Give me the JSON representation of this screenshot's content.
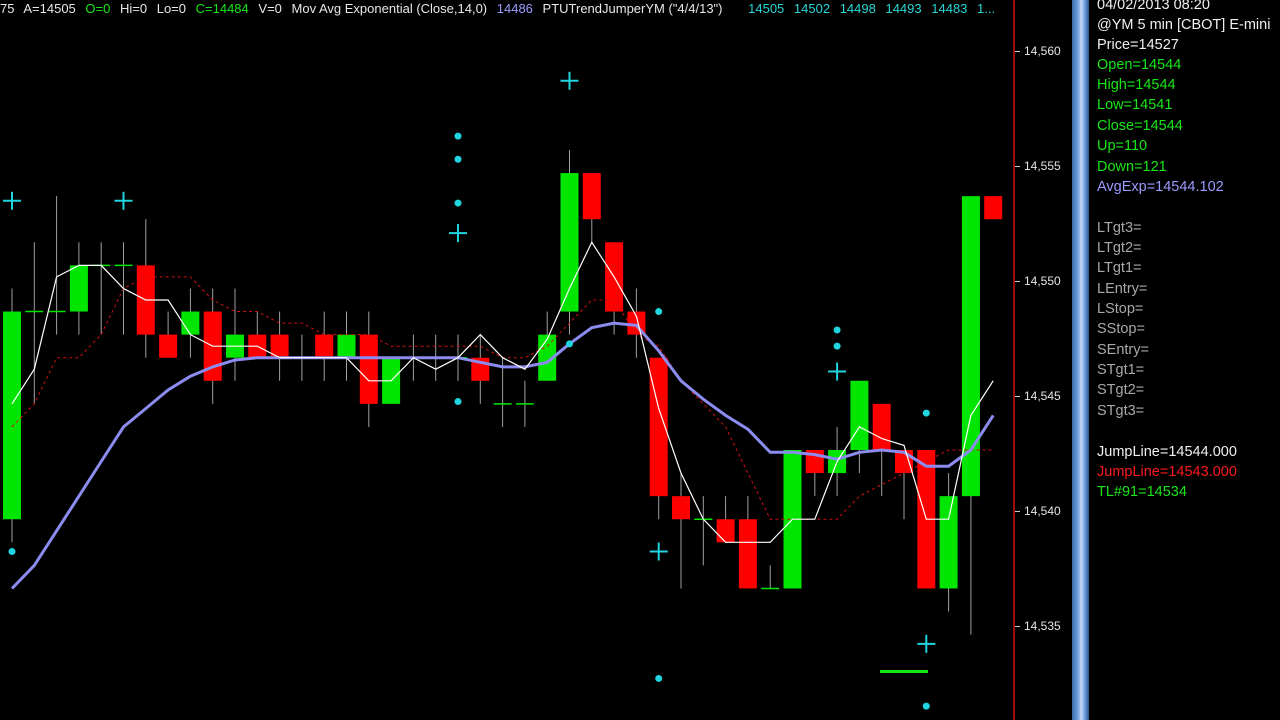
{
  "header": {
    "partial": "75",
    "ask": "A=14505",
    "open": "O=0",
    "high": "Hi=0",
    "low": "Lo=0",
    "close": "C=14484",
    "volume": "V=0",
    "indicator1_name": "Mov Avg Exponential (Close,14,0)",
    "indicator1_value": "14486",
    "indicator2_name": "PTUTrendJumperYM (\"4/4/13\")",
    "indicator2_values": [
      "14505",
      "14502",
      "14498",
      "14493",
      "14483",
      "1..."
    ]
  },
  "colors": {
    "background": "#000000",
    "up_candle": "#00e600",
    "down_candle": "#ff0000",
    "ema": "#8c8cf0",
    "trend_line": "#ffffff",
    "dotted_line": "#cc1111",
    "markers": "#20d4e0",
    "jump_line": "#19e619",
    "cursor_line": "#d01010"
  },
  "price_axis": {
    "ticks": [
      "14,560",
      "14,555",
      "14,550",
      "14,545",
      "14,540",
      "14,535"
    ]
  },
  "info_panel": {
    "datetime": "04/02/2013 08:20",
    "symbol": "@YM 5 min [CBOT] E-mini",
    "price": "Price=14527",
    "open": "Open=14544",
    "high": "High=14544",
    "low": "Low=14541",
    "close": "Close=14544",
    "up": "Up=110",
    "down": "Down=121",
    "avg_exp": "AvgExp=14544.102",
    "targets": [
      "LTgt3=",
      "LTgt2=",
      "LTgt1=",
      "LEntry=",
      "LStop=",
      "SStop=",
      "SEntry=",
      "STgt1=",
      "STgt2=",
      "STgt3="
    ],
    "jumpline_green": "JumpLine=14544.000",
    "jumpline_red": "JumpLine=14543.000",
    "tl": "TL#91=14534"
  },
  "chart_data": {
    "type": "candlestick",
    "title": "@YM 5 min [CBOT] E-mini",
    "ylim": [
      14532.3,
      14563.5
    ],
    "y_ticks": [
      14535,
      14540,
      14545,
      14550,
      14555,
      14560
    ],
    "bars": [
      {
        "o": 14541,
        "h": 14551,
        "l": 14540,
        "c": 14550
      },
      {
        "o": 14550,
        "h": 14553,
        "l": 14546,
        "c": 14550
      },
      {
        "o": 14550,
        "h": 14555,
        "l": 14549,
        "c": 14550
      },
      {
        "o": 14550,
        "h": 14553,
        "l": 14549,
        "c": 14552
      },
      {
        "o": 14552,
        "h": 14553,
        "l": 14549,
        "c": 14552
      },
      {
        "o": 14552,
        "h": 14553,
        "l": 14549,
        "c": 14552
      },
      {
        "o": 14552,
        "h": 14554,
        "l": 14548,
        "c": 14549
      },
      {
        "o": 14549,
        "h": 14550,
        "l": 14548,
        "c": 14548
      },
      {
        "o": 14549,
        "h": 14551,
        "l": 14548,
        "c": 14550
      },
      {
        "o": 14550,
        "h": 14551,
        "l": 14546,
        "c": 14547
      },
      {
        "o": 14548,
        "h": 14551,
        "l": 14547,
        "c": 14549
      },
      {
        "o": 14549,
        "h": 14550,
        "l": 14548,
        "c": 14548
      },
      {
        "o": 14549,
        "h": 14550,
        "l": 14547,
        "c": 14548
      },
      {
        "o": 14548,
        "h": 14549,
        "l": 14547,
        "c": 14548
      },
      {
        "o": 14549,
        "h": 14550,
        "l": 14547,
        "c": 14548
      },
      {
        "o": 14548,
        "h": 14550,
        "l": 14547,
        "c": 14549
      },
      {
        "o": 14549,
        "h": 14550,
        "l": 14545,
        "c": 14546
      },
      {
        "o": 14546,
        "h": 14548,
        "l": 14546,
        "c": 14548
      },
      {
        "o": 14548,
        "h": 14549,
        "l": 14547,
        "c": 14548
      },
      {
        "o": 14548,
        "h": 14549,
        "l": 14547,
        "c": 14548
      },
      {
        "o": 14548,
        "h": 14549,
        "l": 14547,
        "c": 14548
      },
      {
        "o": 14548,
        "h": 14549,
        "l": 14546,
        "c": 14547
      },
      {
        "o": 14546,
        "h": 14548,
        "l": 14545,
        "c": 14546
      },
      {
        "o": 14546,
        "h": 14547,
        "l": 14545,
        "c": 14546
      },
      {
        "o": 14547,
        "h": 14550,
        "l": 14547,
        "c": 14549
      },
      {
        "o": 14550,
        "h": 14557,
        "l": 14549,
        "c": 14556
      },
      {
        "o": 14556,
        "h": 14556,
        "l": 14553,
        "c": 14554
      },
      {
        "o": 14553,
        "h": 14553,
        "l": 14549,
        "c": 14550
      },
      {
        "o": 14550,
        "h": 14551,
        "l": 14548,
        "c": 14549
      },
      {
        "o": 14548,
        "h": 14548,
        "l": 14541,
        "c": 14542
      },
      {
        "o": 14542,
        "h": 14543,
        "l": 14538,
        "c": 14541
      },
      {
        "o": 14541,
        "h": 14542,
        "l": 14539,
        "c": 14541
      },
      {
        "o": 14541,
        "h": 14542,
        "l": 14540,
        "c": 14540
      },
      {
        "o": 14541,
        "h": 14542,
        "l": 14538,
        "c": 14538
      },
      {
        "o": 14538,
        "h": 14539,
        "l": 14538,
        "c": 14538
      },
      {
        "o": 14538,
        "h": 14544,
        "l": 14538,
        "c": 14544
      },
      {
        "o": 14544,
        "h": 14544,
        "l": 14542,
        "c": 14543
      },
      {
        "o": 14543,
        "h": 14545,
        "l": 14542,
        "c": 14544
      },
      {
        "o": 14544,
        "h": 14547,
        "l": 14543,
        "c": 14547
      },
      {
        "o": 14546,
        "h": 14546,
        "l": 14542,
        "c": 14544
      },
      {
        "o": 14544,
        "h": 14544,
        "l": 14541,
        "c": 14543
      },
      {
        "o": 14544,
        "h": 14544,
        "l": 14538,
        "c": 14538
      },
      {
        "o": 14538,
        "h": 14543,
        "l": 14537,
        "c": 14542
      },
      {
        "o": 14542,
        "h": 14555,
        "l": 14536,
        "c": 14555
      },
      {
        "o": 14555,
        "h": 14555,
        "l": 14554,
        "c": 14554
      }
    ],
    "ema": [
      14538,
      14539,
      14540.5,
      14542,
      14543.5,
      14545,
      14545.8,
      14546.6,
      14547.2,
      14547.6,
      14547.9,
      14548,
      14548,
      14548,
      14548,
      14548,
      14548,
      14548,
      14548,
      14548,
      14548,
      14547.8,
      14547.6,
      14547.6,
      14547.8,
      14548.6,
      14549.3,
      14549.5,
      14549.4,
      14548.3,
      14547,
      14546.2,
      14545.5,
      14544.9,
      14543.9,
      14543.9,
      14543.8,
      14543.6,
      14543.9,
      14544,
      14543.9,
      14543.3,
      14543.3,
      14544,
      14545.5
    ],
    "trend": [
      14546,
      14547.5,
      14551.5,
      14552,
      14552,
      14551,
      14550.5,
      14550.5,
      14549,
      14548.5,
      14548.5,
      14548.5,
      14548,
      14548,
      14548,
      14548,
      14547,
      14547,
      14548,
      14547.5,
      14548,
      14549,
      14548,
      14547.5,
      14548.8,
      14551,
      14553,
      14551.5,
      14549.8,
      14545.8,
      14543,
      14541,
      14540,
      14540,
      14540,
      14541,
      14541,
      14543.5,
      14545,
      14544.5,
      14544.2,
      14541,
      14541,
      14545.5,
      14547
    ],
    "dotted": [
      14545,
      14546,
      14548,
      14548,
      14549,
      14551,
      14551.5,
      14551.5,
      14551.5,
      14550.5,
      14550,
      14550,
      14549.5,
      14549.5,
      14549,
      14549,
      14549,
      14548.5,
      14548.5,
      14548.5,
      14548.5,
      14548.5,
      14548,
      14548,
      14548.5,
      14549.5,
      14550.5,
      14550.5,
      14549,
      14548.5,
      14547,
      14546,
      14545,
      14543,
      14541,
      14541,
      14541,
      14541,
      14542,
      14542.5,
      14543,
      14543.5,
      14544,
      14544,
      14544
    ],
    "plus_markers": [
      {
        "bar": 0,
        "price": 14554.8
      },
      {
        "bar": 5,
        "price": 14554.8
      },
      {
        "bar": 25,
        "price": 14560
      },
      {
        "bar": 20,
        "price": 14553.4
      },
      {
        "bar": 29,
        "price": 14539.6
      },
      {
        "bar": 37,
        "price": 14547.4
      },
      {
        "bar": 41,
        "price": 14535.6
      }
    ],
    "dot_markers": [
      {
        "bar": 0,
        "price": 14539.6
      },
      {
        "bar": 20,
        "price": 14557.6
      },
      {
        "bar": 20,
        "price": 14556.6
      },
      {
        "bar": 20,
        "price": 14554.7
      },
      {
        "bar": 20,
        "price": 14546.1
      },
      {
        "bar": 25,
        "price": 14548.6
      },
      {
        "bar": 29,
        "price": 14550
      },
      {
        "bar": 29,
        "price": 14534.1
      },
      {
        "bar": 37,
        "price": 14549.2
      },
      {
        "bar": 37,
        "price": 14548.5
      },
      {
        "bar": 41,
        "price": 14545.6
      },
      {
        "bar": 41,
        "price": 14532.9
      }
    ],
    "jump_segments": [
      {
        "bar": 40,
        "price": 14534.4
      }
    ]
  }
}
